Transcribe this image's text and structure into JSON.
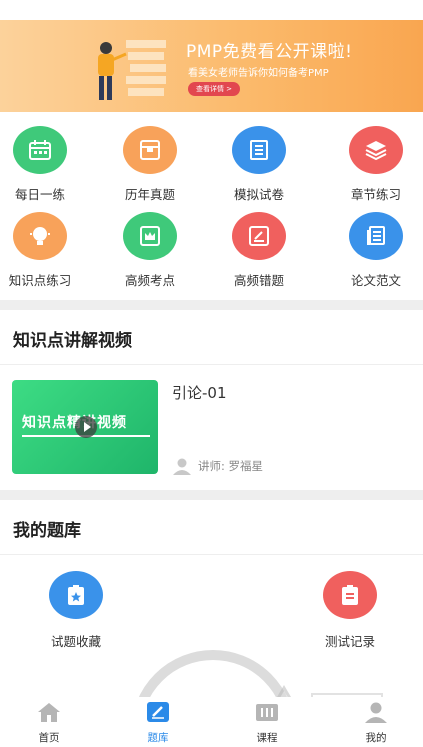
{
  "banner": {
    "title": "PMP免费看公开课啦!",
    "subtitle": "看美女老师告诉你如何备考PMP",
    "button_label": "查看详情 >"
  },
  "grid_items": [
    {
      "label": "每日一练",
      "icon": "calendar-icon",
      "color": "#3fc97a"
    },
    {
      "label": "历年真题",
      "icon": "box-icon",
      "color": "#f8a25a"
    },
    {
      "label": "模拟试卷",
      "icon": "scroll-icon",
      "color": "#3a92ea"
    },
    {
      "label": "章节练习",
      "icon": "layers-icon",
      "color": "#f0605e"
    },
    {
      "label": "知识点练习",
      "icon": "lightbulb-icon",
      "color": "#f8a25a"
    },
    {
      "label": "高频考点",
      "icon": "crown-icon",
      "color": "#3fc97a"
    },
    {
      "label": "高频错题",
      "icon": "pencil-note-icon",
      "color": "#f0605e"
    },
    {
      "label": "论文范文",
      "icon": "document-icon",
      "color": "#3a92ea"
    }
  ],
  "video_section": {
    "title": "知识点讲解视频",
    "thumbnail_text": "知识点精讲视频",
    "video_title": "引论-01",
    "lecturer": "讲师: 罗福星"
  },
  "library_section": {
    "title": "我的题库",
    "items": [
      {
        "label": "试题收藏",
        "icon": "star-clipboard-icon",
        "color": "#3a92ea"
      },
      {
        "label": "测试记录",
        "icon": "record-clipboard-icon",
        "color": "#f0605e"
      }
    ]
  },
  "tabs": [
    {
      "label": "首页",
      "icon": "home-icon",
      "active": false
    },
    {
      "label": "题库",
      "icon": "edit-icon",
      "active": true
    },
    {
      "label": "课程",
      "icon": "course-icon",
      "active": false
    },
    {
      "label": "我的",
      "icon": "user-icon",
      "active": false
    }
  ],
  "colors": {
    "accent": "#2b8ae8",
    "banner": "#fbb96a",
    "divider": "#eeeeee"
  }
}
